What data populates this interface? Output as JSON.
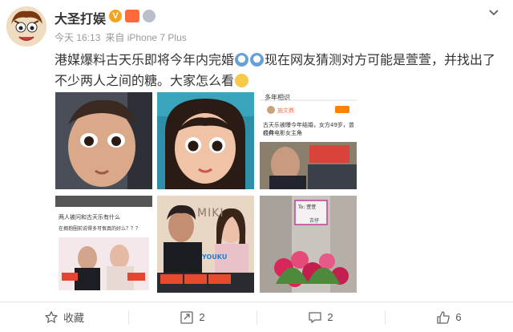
{
  "post": {
    "author": "大圣打娱",
    "verified_badge": "V",
    "time": "今天 16:13",
    "source": "来自 iPhone 7 Plus",
    "text_a": "港媒爆料古天乐即将今年内完婚",
    "text_b": "现在网友猜测对方可能是萱萱，并找出了不少两人之间的糖。大家怎么看",
    "emoji_icons": [
      "surprised-face-icon",
      "surprised-face-icon",
      "thinking-face-icon"
    ]
  },
  "images": {
    "img3": {
      "title": "多年相识",
      "username": "施文鼎",
      "line1": "古天乐被曝今年结婚，女方49岁，曾合作",
      "line2": "经典电影女主角"
    },
    "img4": {
      "line1": "两人被问和古天乐有什么",
      "line2": "在拥抱圈前说得多可恨真的好么？？？"
    },
    "img5": {
      "brand": "MIKI",
      "logo": "YOUKU"
    },
    "img6": {
      "card_to": "To: 萱萱",
      "card_sign": "古仔"
    }
  },
  "actions": {
    "favorite": "收藏",
    "repost_count": "2",
    "comment_count": "2",
    "like_count": "6"
  },
  "colors": {
    "accent_orange": "#ff8200",
    "vip_badge": "#f7a21c",
    "text_gray": "#999999"
  }
}
